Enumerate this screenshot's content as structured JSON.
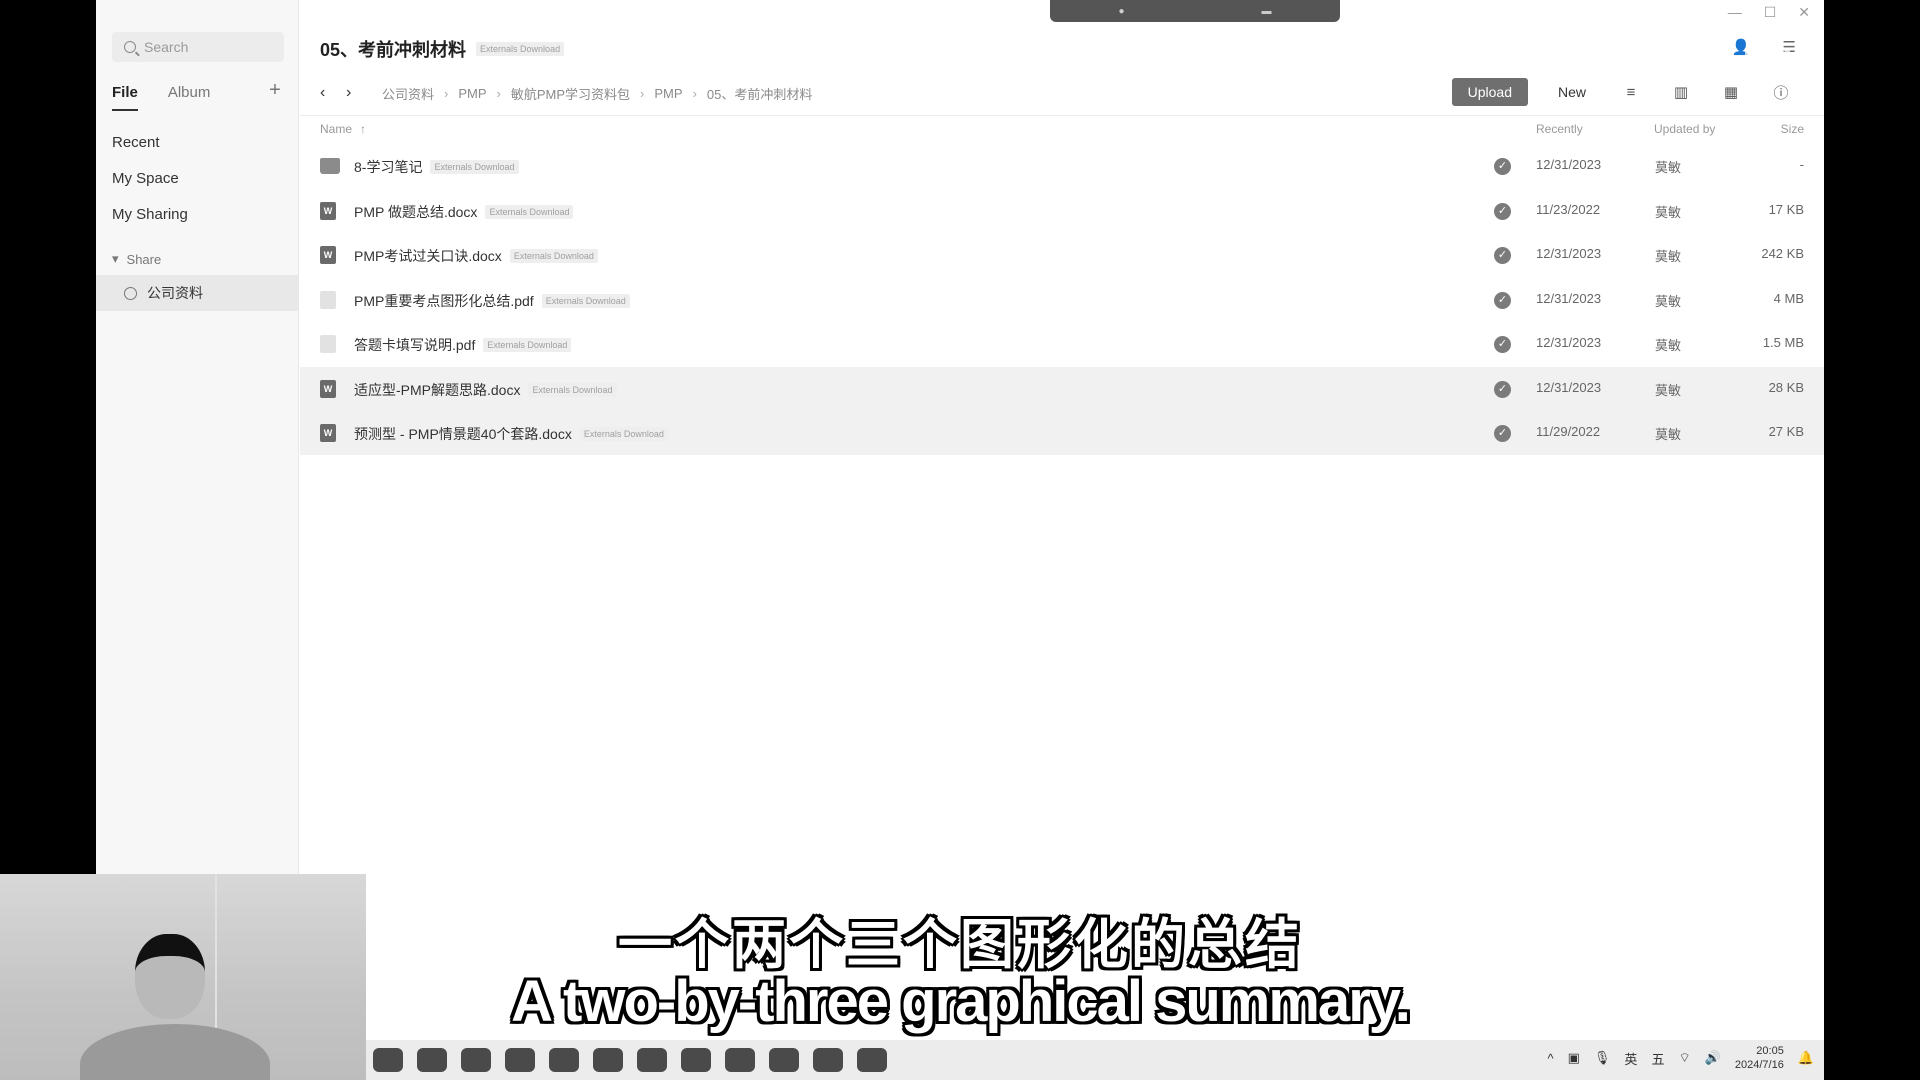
{
  "sidebar": {
    "search_placeholder": "Search",
    "tabs": [
      "File",
      "Album"
    ],
    "add_label": "+",
    "nav": [
      "Recent",
      "My Space",
      "My Sharing"
    ],
    "share_header": "Share",
    "share_item": "公司资料"
  },
  "header": {
    "title": "05、考前冲刺材料",
    "title_badge": "Externals Download"
  },
  "breadcrumb": [
    "公司资料",
    "PMP",
    "敏航PMP学习资料包",
    "PMP",
    "05、考前冲刺材料"
  ],
  "toolbar": {
    "upload": "Upload",
    "new": "New"
  },
  "columns": {
    "name": "Name",
    "recently": "Recently",
    "updated_by": "Updated by",
    "size": "Size"
  },
  "files": [
    {
      "name": "8-学习笔记",
      "type": "folder",
      "badge": "Externals Download",
      "date": "12/31/2023",
      "by": "莫敏",
      "size": "-"
    },
    {
      "name": "PMP 做题总结.docx",
      "type": "doc",
      "badge": "Externals Download",
      "date": "11/23/2022",
      "by": "莫敏",
      "size": "17 KB"
    },
    {
      "name": "PMP考试过关口诀.docx",
      "type": "doc",
      "badge": "Externals Download",
      "date": "12/31/2023",
      "by": "莫敏",
      "size": "242 KB"
    },
    {
      "name": "PMP重要考点图形化总结.pdf",
      "type": "pdf",
      "badge": "Externals Download",
      "date": "12/31/2023",
      "by": "莫敏",
      "size": "4 MB"
    },
    {
      "name": "答题卡填写说明.pdf",
      "type": "pdf",
      "badge": "Externals Download",
      "date": "12/31/2023",
      "by": "莫敏",
      "size": "1.5 MB"
    },
    {
      "name": "适应型-PMP解题思路.docx",
      "type": "doc",
      "badge": "Externals Download",
      "date": "12/31/2023",
      "by": "莫敏",
      "size": "28 KB"
    },
    {
      "name": "预测型 - PMP情景题40个套路.docx",
      "type": "doc",
      "badge": "Externals Download",
      "date": "11/29/2022",
      "by": "莫敏",
      "size": "27 KB"
    }
  ],
  "subtitles": {
    "zh": "一个两个三个图形化的总结",
    "en": "A two-by-three graphical summary."
  },
  "clock": {
    "time": "20:05",
    "date": "2024/7/16"
  },
  "tray_ime": [
    "英",
    "五"
  ]
}
